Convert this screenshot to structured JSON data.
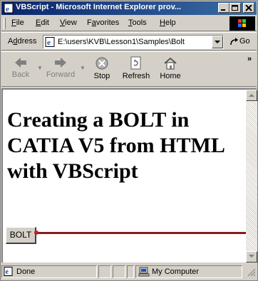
{
  "window": {
    "title": "VBScript - Microsoft Internet Explorer prov...",
    "controls": [
      "minimize",
      "maximize",
      "close"
    ]
  },
  "menu": {
    "items": [
      {
        "underline": "F",
        "rest": "ile"
      },
      {
        "underline": "E",
        "rest": "dit"
      },
      {
        "underline": "V",
        "rest": "iew"
      },
      {
        "pre": "F",
        "underline": "a",
        "rest": "vorites"
      },
      {
        "underline": "T",
        "rest": "ools"
      },
      {
        "underline": "H",
        "rest": "elp"
      }
    ]
  },
  "address": {
    "label_underline": "d",
    "label_pre": "A",
    "label_rest": "dress",
    "value": "E:\\users\\KVB\\Lesson1\\Samples\\Bolt",
    "go_label": "Go"
  },
  "toolbar": {
    "back": "Back",
    "forward": "Forward",
    "stop": "Stop",
    "refresh": "Refresh",
    "home": "Home",
    "more": "»"
  },
  "content": {
    "heading": "Creating a BOLT in CATIA V5 from HTML with VBScript",
    "button_label": "BOLT"
  },
  "status": {
    "text": "Done",
    "zone": "My Computer"
  },
  "icons": {
    "title": "ie-page-icon",
    "address": "ie-page-icon",
    "go": "go-arrow-icon",
    "back": "back-arrow-icon",
    "forward": "forward-arrow-icon",
    "stop": "stop-icon",
    "refresh": "refresh-icon",
    "home": "home-icon",
    "zone": "computer-icon"
  },
  "colors": {
    "titlebar_start": "#0a246a",
    "titlebar_end": "#3a6ea5",
    "chrome": "#d4d0c8",
    "pointer_line": "#8b1a1a"
  }
}
